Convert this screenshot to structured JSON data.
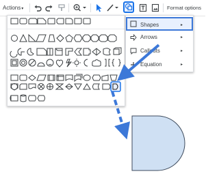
{
  "toolbar": {
    "actions_label": "Actions",
    "caret": "▾",
    "format_options_label": "Format options"
  },
  "shape_menu": {
    "arrow_glyph": "▸",
    "items": [
      {
        "label": "Shapes",
        "icon": "square-shape-icon",
        "active": true
      },
      {
        "label": "Arrows",
        "icon": "arrow-icon",
        "active": false
      },
      {
        "label": "Callouts",
        "icon": "callout-icon",
        "active": false
      },
      {
        "label": "Equation",
        "icon": "plus-icon",
        "active": false
      }
    ]
  },
  "palette": {
    "sections": [
      "Shapes",
      "Arrows",
      "Callouts",
      "Equation"
    ],
    "selected_shape": "flowchart-delay-shape"
  },
  "colors": {
    "accent": "#3c78d8",
    "selection": "#1a73e8",
    "shape_fill": "#cfe0f3",
    "shape_stroke": "#3d4a5c"
  }
}
